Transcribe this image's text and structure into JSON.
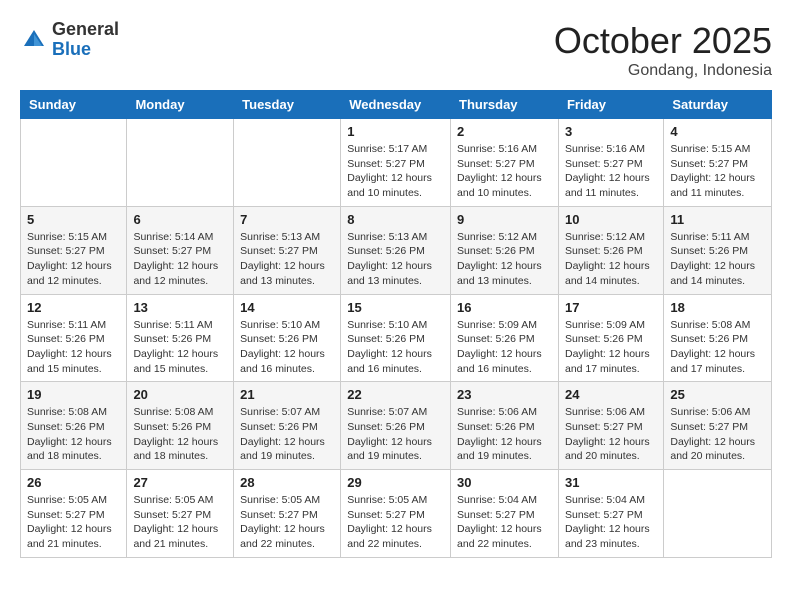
{
  "app": {
    "logo_general": "General",
    "logo_blue": "Blue"
  },
  "header": {
    "month": "October 2025",
    "location": "Gondang, Indonesia"
  },
  "weekdays": [
    "Sunday",
    "Monday",
    "Tuesday",
    "Wednesday",
    "Thursday",
    "Friday",
    "Saturday"
  ],
  "weeks": [
    [
      {
        "day": "",
        "info": ""
      },
      {
        "day": "",
        "info": ""
      },
      {
        "day": "",
        "info": ""
      },
      {
        "day": "1",
        "info": "Sunrise: 5:17 AM\nSunset: 5:27 PM\nDaylight: 12 hours\nand 10 minutes."
      },
      {
        "day": "2",
        "info": "Sunrise: 5:16 AM\nSunset: 5:27 PM\nDaylight: 12 hours\nand 10 minutes."
      },
      {
        "day": "3",
        "info": "Sunrise: 5:16 AM\nSunset: 5:27 PM\nDaylight: 12 hours\nand 11 minutes."
      },
      {
        "day": "4",
        "info": "Sunrise: 5:15 AM\nSunset: 5:27 PM\nDaylight: 12 hours\nand 11 minutes."
      }
    ],
    [
      {
        "day": "5",
        "info": "Sunrise: 5:15 AM\nSunset: 5:27 PM\nDaylight: 12 hours\nand 12 minutes."
      },
      {
        "day": "6",
        "info": "Sunrise: 5:14 AM\nSunset: 5:27 PM\nDaylight: 12 hours\nand 12 minutes."
      },
      {
        "day": "7",
        "info": "Sunrise: 5:13 AM\nSunset: 5:27 PM\nDaylight: 12 hours\nand 13 minutes."
      },
      {
        "day": "8",
        "info": "Sunrise: 5:13 AM\nSunset: 5:26 PM\nDaylight: 12 hours\nand 13 minutes."
      },
      {
        "day": "9",
        "info": "Sunrise: 5:12 AM\nSunset: 5:26 PM\nDaylight: 12 hours\nand 13 minutes."
      },
      {
        "day": "10",
        "info": "Sunrise: 5:12 AM\nSunset: 5:26 PM\nDaylight: 12 hours\nand 14 minutes."
      },
      {
        "day": "11",
        "info": "Sunrise: 5:11 AM\nSunset: 5:26 PM\nDaylight: 12 hours\nand 14 minutes."
      }
    ],
    [
      {
        "day": "12",
        "info": "Sunrise: 5:11 AM\nSunset: 5:26 PM\nDaylight: 12 hours\nand 15 minutes."
      },
      {
        "day": "13",
        "info": "Sunrise: 5:11 AM\nSunset: 5:26 PM\nDaylight: 12 hours\nand 15 minutes."
      },
      {
        "day": "14",
        "info": "Sunrise: 5:10 AM\nSunset: 5:26 PM\nDaylight: 12 hours\nand 16 minutes."
      },
      {
        "day": "15",
        "info": "Sunrise: 5:10 AM\nSunset: 5:26 PM\nDaylight: 12 hours\nand 16 minutes."
      },
      {
        "day": "16",
        "info": "Sunrise: 5:09 AM\nSunset: 5:26 PM\nDaylight: 12 hours\nand 16 minutes."
      },
      {
        "day": "17",
        "info": "Sunrise: 5:09 AM\nSunset: 5:26 PM\nDaylight: 12 hours\nand 17 minutes."
      },
      {
        "day": "18",
        "info": "Sunrise: 5:08 AM\nSunset: 5:26 PM\nDaylight: 12 hours\nand 17 minutes."
      }
    ],
    [
      {
        "day": "19",
        "info": "Sunrise: 5:08 AM\nSunset: 5:26 PM\nDaylight: 12 hours\nand 18 minutes."
      },
      {
        "day": "20",
        "info": "Sunrise: 5:08 AM\nSunset: 5:26 PM\nDaylight: 12 hours\nand 18 minutes."
      },
      {
        "day": "21",
        "info": "Sunrise: 5:07 AM\nSunset: 5:26 PM\nDaylight: 12 hours\nand 19 minutes."
      },
      {
        "day": "22",
        "info": "Sunrise: 5:07 AM\nSunset: 5:26 PM\nDaylight: 12 hours\nand 19 minutes."
      },
      {
        "day": "23",
        "info": "Sunrise: 5:06 AM\nSunset: 5:26 PM\nDaylight: 12 hours\nand 19 minutes."
      },
      {
        "day": "24",
        "info": "Sunrise: 5:06 AM\nSunset: 5:27 PM\nDaylight: 12 hours\nand 20 minutes."
      },
      {
        "day": "25",
        "info": "Sunrise: 5:06 AM\nSunset: 5:27 PM\nDaylight: 12 hours\nand 20 minutes."
      }
    ],
    [
      {
        "day": "26",
        "info": "Sunrise: 5:05 AM\nSunset: 5:27 PM\nDaylight: 12 hours\nand 21 minutes."
      },
      {
        "day": "27",
        "info": "Sunrise: 5:05 AM\nSunset: 5:27 PM\nDaylight: 12 hours\nand 21 minutes."
      },
      {
        "day": "28",
        "info": "Sunrise: 5:05 AM\nSunset: 5:27 PM\nDaylight: 12 hours\nand 22 minutes."
      },
      {
        "day": "29",
        "info": "Sunrise: 5:05 AM\nSunset: 5:27 PM\nDaylight: 12 hours\nand 22 minutes."
      },
      {
        "day": "30",
        "info": "Sunrise: 5:04 AM\nSunset: 5:27 PM\nDaylight: 12 hours\nand 22 minutes."
      },
      {
        "day": "31",
        "info": "Sunrise: 5:04 AM\nSunset: 5:27 PM\nDaylight: 12 hours\nand 23 minutes."
      },
      {
        "day": "",
        "info": ""
      }
    ]
  ]
}
